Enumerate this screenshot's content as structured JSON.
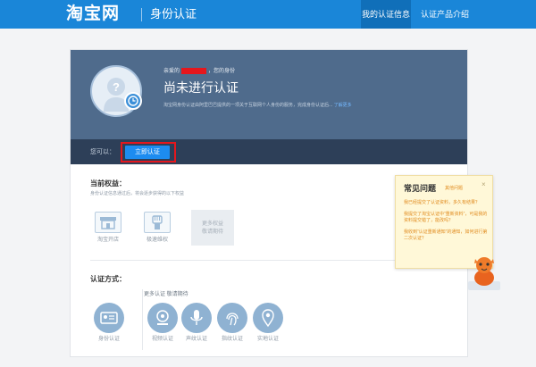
{
  "header": {
    "logo": "淘宝网",
    "app_title": "身份认证",
    "nav": [
      {
        "label": "我的认证信息"
      },
      {
        "label": "认证产品介绍"
      }
    ]
  },
  "hero": {
    "greeting_prefix": "亲爱的",
    "greeting_suffix": "，您的身份",
    "status": "尚未进行认证",
    "description": "淘宝网身份认证由阿里巴巴提供的一项关于互联网个人身份的服务，完成身份认证后...",
    "description_link": "了解更多"
  },
  "action_bar": {
    "you_can": "您可以：",
    "verify_button": "立即认证"
  },
  "rights": {
    "title": "当前权益：",
    "subtitle": "身份认证信息通过后，将会逐步获得的以下权益",
    "items": [
      {
        "label": "淘宝开店",
        "icon": "shop-icon"
      },
      {
        "label": "极速维权",
        "icon": "fist-icon"
      }
    ],
    "more": [
      "更多权益",
      "敬请期待"
    ]
  },
  "methods": {
    "title": "认证方式：",
    "more_label": "更多认证 敬请期待",
    "items": [
      {
        "label": "身份认证",
        "icon": "id-card-icon"
      },
      {
        "label": "视频认证",
        "icon": "camera-icon"
      },
      {
        "label": "声纹认证",
        "icon": "microphone-icon"
      },
      {
        "label": "指纹认证",
        "icon": "fingerprint-icon"
      },
      {
        "label": "实地认证",
        "icon": "location-pin-icon"
      }
    ]
  },
  "faq": {
    "title": "常见问题",
    "subtitle": "其他问题",
    "close": "×",
    "items": [
      "我已经提交了认证资料，多久有结果？",
      "我提交了淘宝认证中“重新资料”，可是我的资料提交错了，能改吗？",
      "我收到“认证重新通知”的通知，如何进行第二次认证？"
    ]
  },
  "colors": {
    "topbar": "#1a86d8",
    "hero": "#4f6b8c",
    "action_bar": "#2d3f58",
    "button": "#1d8cf0",
    "highlight": "#e5171d",
    "faq_bg": "#fff8d8",
    "faq_accent": "#e08a1d"
  }
}
